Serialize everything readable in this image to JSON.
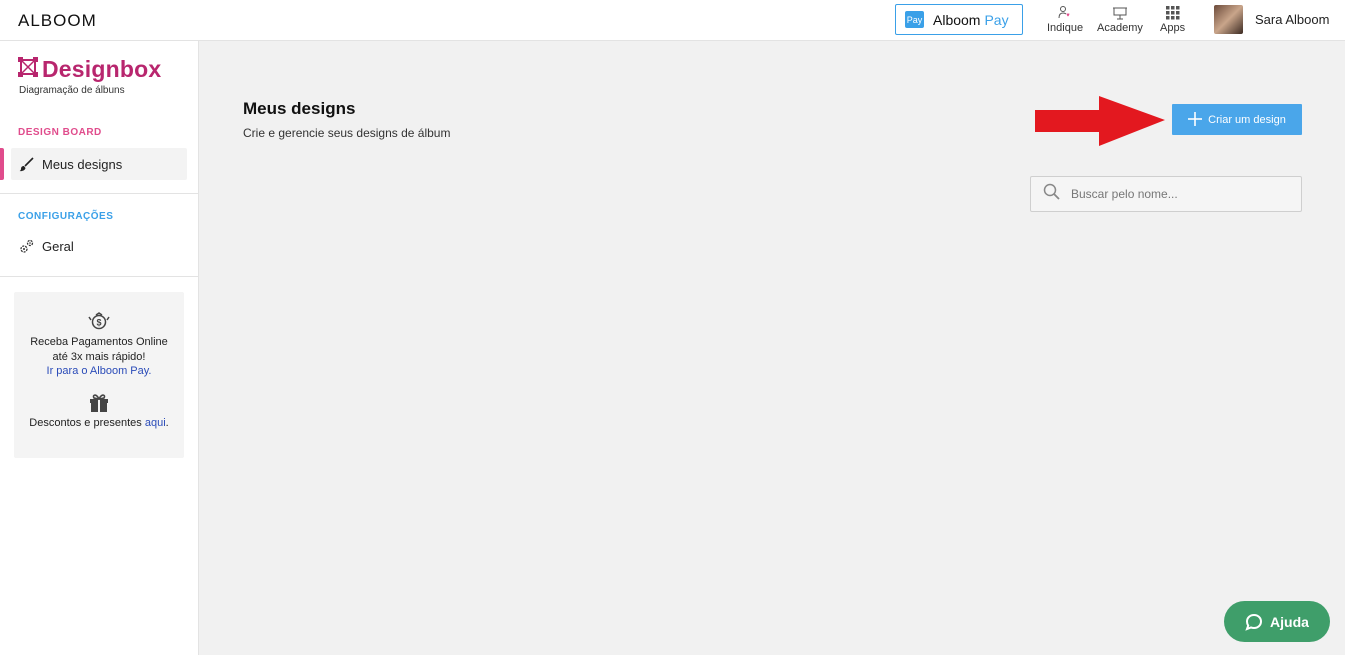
{
  "topbar": {
    "brand": "ALBOOM",
    "pay_badge": "Pay",
    "pay_name": "Alboom",
    "pay_name_accent": "Pay",
    "items": [
      {
        "label": "Indique",
        "icon": "person-heart-icon"
      },
      {
        "label": "Academy",
        "icon": "presentation-board-icon"
      },
      {
        "label": "Apps",
        "icon": "grid-icon"
      }
    ],
    "username": "Sara Alboom"
  },
  "sidebar": {
    "app_name": "Designbox",
    "app_sub": "Diagramação de álbuns",
    "sections": [
      {
        "label": "DESIGN BOARD",
        "color": "#e04c8c",
        "items": [
          {
            "label": "Meus designs",
            "icon": "brush-icon"
          }
        ]
      },
      {
        "label": "CONFIGURAÇÕES",
        "color": "#3aa0e8",
        "items": [
          {
            "label": "Geral",
            "icon": "gears-icon"
          }
        ]
      }
    ],
    "promo": {
      "line1": "Receba Pagamentos Online",
      "line2": "até 3x mais rápido!",
      "link1": "Ir para o Alboom Pay.",
      "line3": "Descontos e presentes",
      "link2": "aqui",
      "line3_end": "."
    }
  },
  "main": {
    "title": "Meus designs",
    "subtitle": "Crie e gerencie seus designs de álbum",
    "create_label": "Criar um design",
    "search_placeholder": "Buscar pelo nome..."
  },
  "help": {
    "label": "Ajuda"
  },
  "colors": {
    "accent": "#4aa6ea",
    "brand": "#b8266e",
    "help": "#3f9e6a",
    "arrow": "#e3181f"
  }
}
